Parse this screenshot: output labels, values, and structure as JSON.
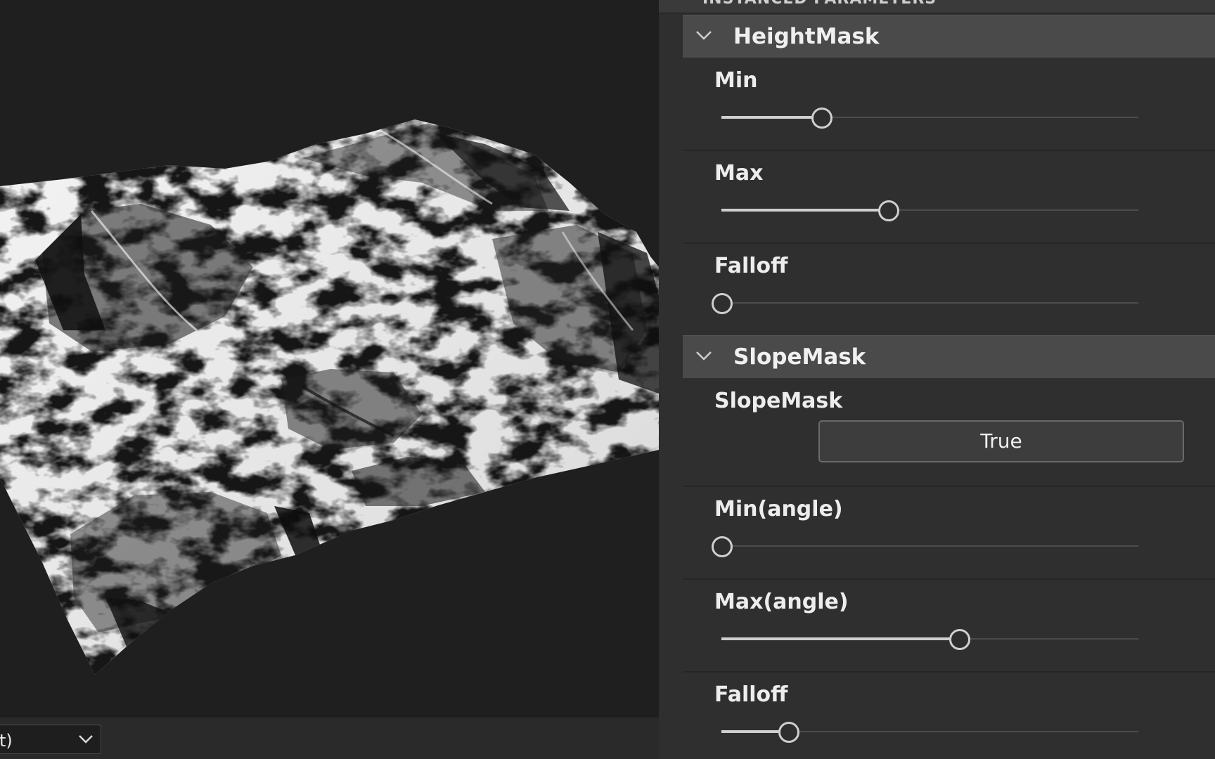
{
  "viewport": {
    "view_mode": "t)"
  },
  "panel": {
    "header_title": "INSTANCED PARAMETERS",
    "sections": [
      {
        "title": "HeightMask",
        "props": [
          {
            "label": "Min",
            "value": 0.24
          },
          {
            "label": "Max",
            "value": 0.4
          },
          {
            "label": "Falloff",
            "value": 0.0
          }
        ]
      },
      {
        "title": "SlopeMask",
        "toggle": {
          "label": "SlopeMask",
          "value": "True"
        },
        "props": [
          {
            "label": "Min(angle)",
            "value": 0.0
          },
          {
            "label": "Max(angle)",
            "value": 0.57
          },
          {
            "label": "Falloff",
            "value": 0.16
          }
        ]
      }
    ]
  },
  "colors": {
    "panel_bg": "#2f2f2f",
    "section_header_bg": "#4a4a4a",
    "viewport_bg": "#1f1f1f",
    "slider_active": "#cfcfcf"
  },
  "icons": {
    "collapse": "chevron-down-icon",
    "dropdown": "chevron-down-icon"
  }
}
